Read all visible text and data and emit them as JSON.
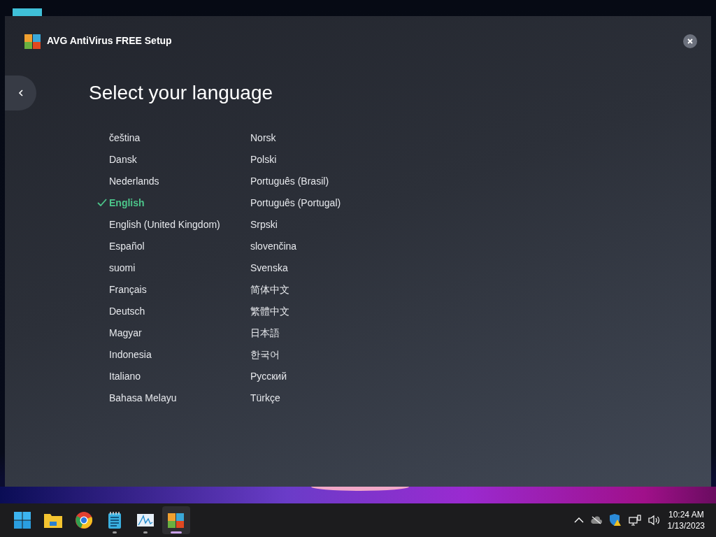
{
  "window": {
    "title": "AVG AntiVirus FREE Setup",
    "heading": "Select your language"
  },
  "language_columns": [
    [
      {
        "label": "čeština",
        "selected": false
      },
      {
        "label": "Dansk",
        "selected": false
      },
      {
        "label": "Nederlands",
        "selected": false
      },
      {
        "label": "English",
        "selected": true
      },
      {
        "label": "English (United Kingdom)",
        "selected": false
      },
      {
        "label": "Español",
        "selected": false
      },
      {
        "label": "suomi",
        "selected": false
      },
      {
        "label": "Français",
        "selected": false
      },
      {
        "label": "Deutsch",
        "selected": false
      },
      {
        "label": "Magyar",
        "selected": false
      },
      {
        "label": "Indonesia",
        "selected": false
      },
      {
        "label": "Italiano",
        "selected": false
      },
      {
        "label": "Bahasa Melayu",
        "selected": false
      }
    ],
    [
      {
        "label": "Norsk",
        "selected": false
      },
      {
        "label": "Polski",
        "selected": false
      },
      {
        "label": "Português (Brasil)",
        "selected": false
      },
      {
        "label": "Português (Portugal)",
        "selected": false
      },
      {
        "label": "Srpski",
        "selected": false
      },
      {
        "label": "slovenčina",
        "selected": false
      },
      {
        "label": "Svenska",
        "selected": false
      },
      {
        "label": "简体中文",
        "selected": false
      },
      {
        "label": "繁體中文",
        "selected": false
      },
      {
        "label": "日本語",
        "selected": false
      },
      {
        "label": "한국어",
        "selected": false
      },
      {
        "label": "Русский",
        "selected": false
      },
      {
        "label": "Türkçe",
        "selected": false
      }
    ]
  ],
  "taskbar": {
    "apps": [
      {
        "kind": "start",
        "running": false,
        "selected": false
      },
      {
        "kind": "explorer",
        "running": false,
        "selected": false
      },
      {
        "kind": "browser",
        "running": false,
        "selected": false
      },
      {
        "kind": "notepad",
        "running": true,
        "selected": false
      },
      {
        "kind": "monitor",
        "running": true,
        "selected": false
      },
      {
        "kind": "avg",
        "running": true,
        "selected": true
      }
    ],
    "time": "10:24 AM",
    "date": "1/13/2023"
  }
}
